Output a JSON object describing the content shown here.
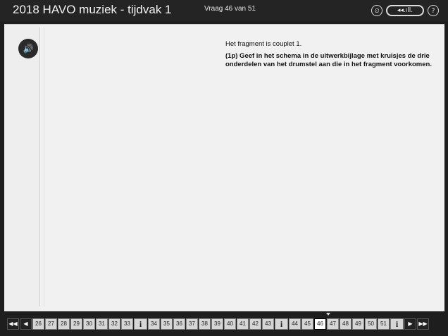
{
  "header": {
    "title": "2018 HAVO muziek - tijdvak 1",
    "counter": "Vraag 46 van 51",
    "timer_icon": "timer-icon",
    "volume_label": "◂◂.ıll.",
    "help_label": "?"
  },
  "content": {
    "fragment_text": "Het fragment is couplet 1.",
    "question_text": "(1p) Geef in het schema in de uitwerkbijlage met kruisjes de drie onderdelen van het drumstel aan die in het fragment voorkomen."
  },
  "nav": {
    "first": "◀◀",
    "prev": "◀",
    "next": "▶",
    "last": "▶▶",
    "info": "i",
    "active": "46",
    "group1": [
      "26",
      "27",
      "28",
      "29",
      "30",
      "31",
      "32",
      "33"
    ],
    "group2": [
      "34",
      "35",
      "36",
      "37",
      "38",
      "39",
      "40",
      "41",
      "42",
      "43"
    ],
    "group3": [
      "44",
      "45",
      "46",
      "47",
      "48",
      "49",
      "50",
      "51"
    ]
  },
  "colors": {
    "background": "#1e1e1e",
    "content": "#f1f1f1",
    "nav_button": "#d6d6d6"
  }
}
